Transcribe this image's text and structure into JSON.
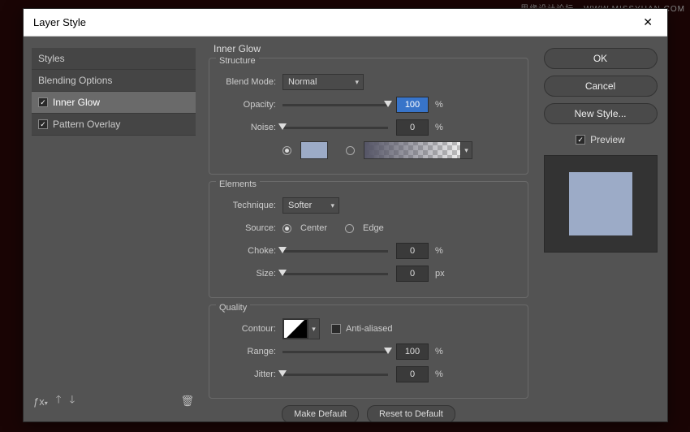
{
  "dialog": {
    "title": "Layer Style"
  },
  "styles_list": {
    "header": "Styles",
    "blending": "Blending Options",
    "inner_glow": "Inner Glow",
    "pattern_overlay": "Pattern Overlay"
  },
  "section": {
    "title": "Inner Glow"
  },
  "structure": {
    "legend": "Structure",
    "blend_mode_label": "Blend Mode:",
    "blend_mode_value": "Normal",
    "opacity_label": "Opacity:",
    "opacity_value": "100",
    "opacity_unit": "%",
    "noise_label": "Noise:",
    "noise_value": "0",
    "noise_unit": "%"
  },
  "elements": {
    "legend": "Elements",
    "technique_label": "Technique:",
    "technique_value": "Softer",
    "source_label": "Source:",
    "source_center": "Center",
    "source_edge": "Edge",
    "choke_label": "Choke:",
    "choke_value": "0",
    "choke_unit": "%",
    "size_label": "Size:",
    "size_value": "0",
    "size_unit": "px"
  },
  "quality": {
    "legend": "Quality",
    "contour_label": "Contour:",
    "antialiased_label": "Anti-aliased",
    "range_label": "Range:",
    "range_value": "100",
    "range_unit": "%",
    "jitter_label": "Jitter:",
    "jitter_value": "0",
    "jitter_unit": "%"
  },
  "buttons": {
    "make_default": "Make Default",
    "reset_default": "Reset to Default",
    "ok": "OK",
    "cancel": "Cancel",
    "new_style": "New Style...",
    "preview": "Preview"
  },
  "colors": {
    "glow_swatch": "#9cabc7",
    "preview_fill": "#9cabc7"
  }
}
